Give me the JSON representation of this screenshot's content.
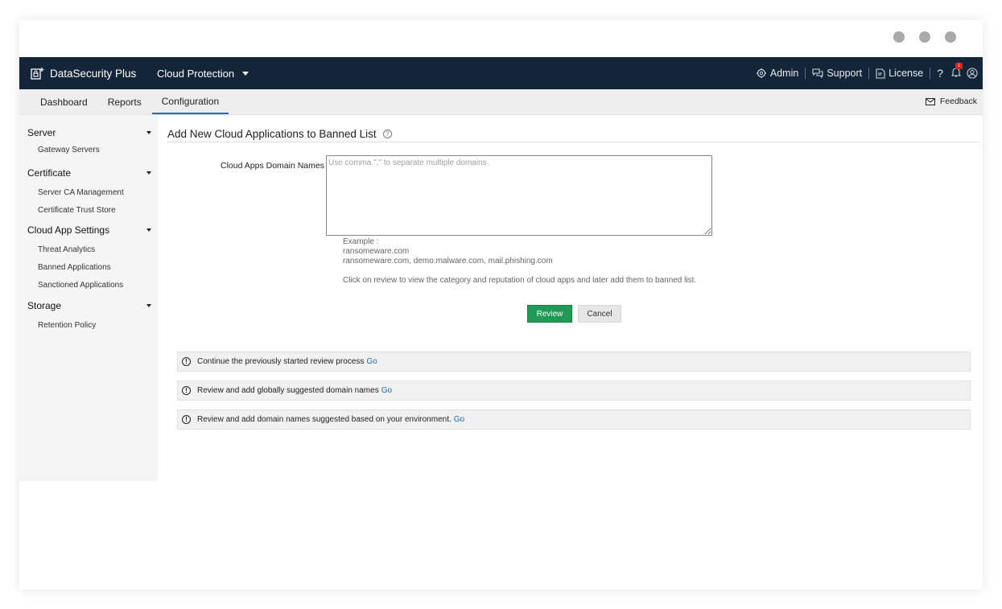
{
  "window": {
    "control_icons": [
      "circle-icon",
      "circle-icon",
      "circle-icon"
    ]
  },
  "header": {
    "brand": "DataSecurity Plus",
    "module": "Cloud Protection",
    "admin": "Admin",
    "support": "Support",
    "license": "License",
    "help": "?",
    "notification_count": "1"
  },
  "tabs": [
    "Dashboard",
    "Reports",
    "Configuration"
  ],
  "feedback": "Feedback",
  "sidebar": {
    "sections": [
      {
        "title": "Server",
        "items": [
          "Gateway Servers"
        ]
      },
      {
        "title": "Certificate",
        "items": [
          "Server CA Management",
          "Certificate Trust Store"
        ]
      },
      {
        "title": "Cloud App Settings",
        "items": [
          "Threat Analytics",
          "Banned Applications",
          "Sanctioned Applications"
        ]
      },
      {
        "title": "Storage",
        "items": [
          "Retention Policy"
        ]
      }
    ]
  },
  "main": {
    "title": "Add New Cloud Applications to Banned List",
    "field_label": "Cloud Apps Domain Names",
    "placeholder": "Use comma \",\" to separate multiple domains",
    "example_label": "Example :",
    "example1": "ransomeware.com",
    "example2": "ransomeware.com, demo.malware.com, mail.phishing.com",
    "instruction": "Click on review to view the category and reputation of cloud apps and later add them to banned list.",
    "review_button": "Review",
    "cancel_button": "Cancel",
    "notices": [
      {
        "text": "Continue the previously started review process",
        "link": "Go"
      },
      {
        "text": "Review and add globally suggested domain names",
        "link": "Go"
      },
      {
        "text": "Review and add domain names suggested based on your environment.",
        "link": "Go"
      }
    ]
  }
}
